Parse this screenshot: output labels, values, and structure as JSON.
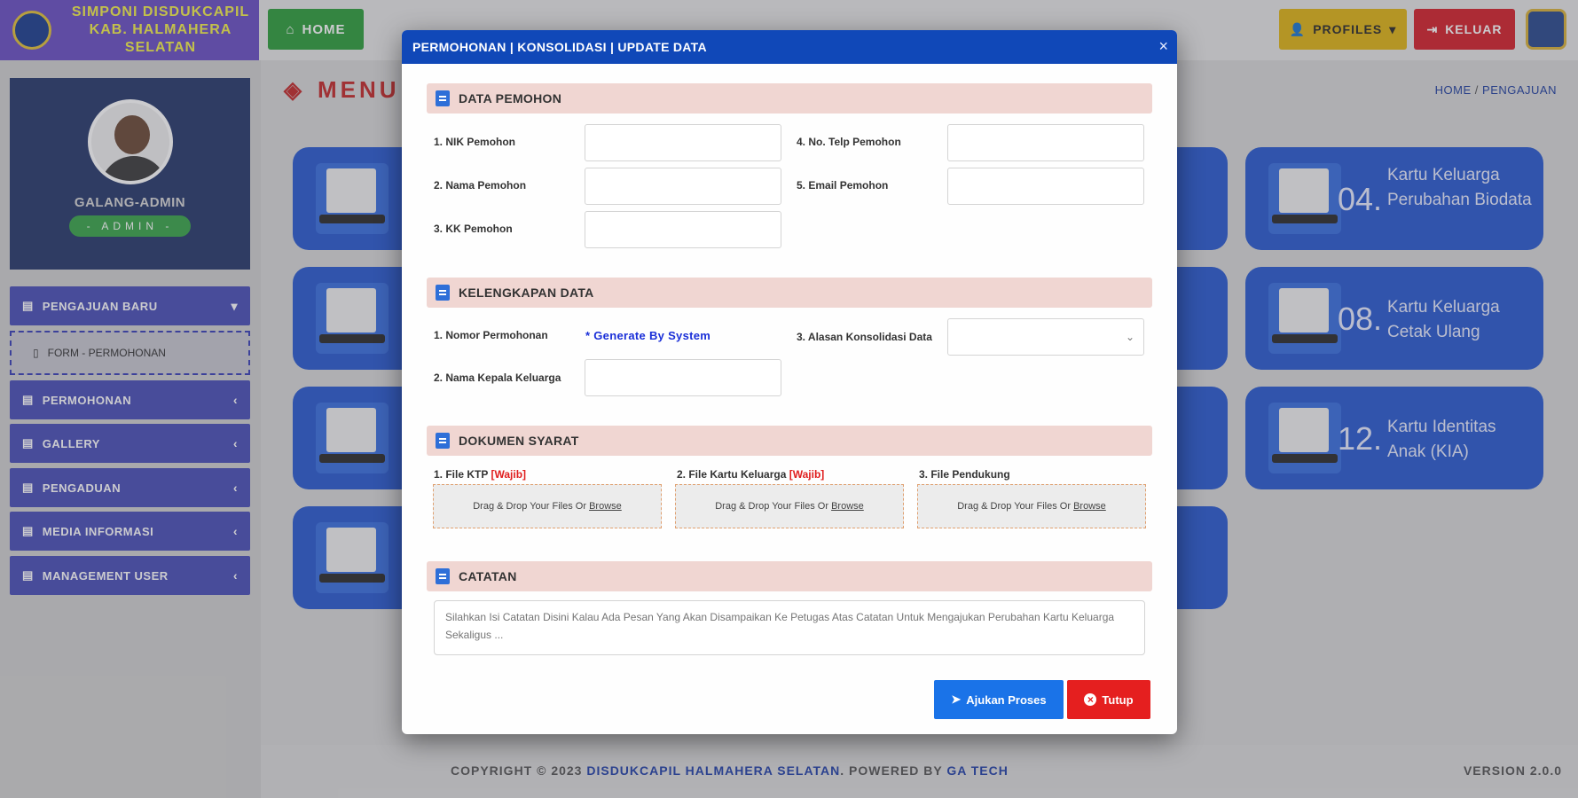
{
  "brand": {
    "line1": "SIMPONI DISDUKCAPIL",
    "line2": "KAB. HALMAHERA SELATAN"
  },
  "topbar": {
    "home": "HOME",
    "profile": "PROFILES",
    "logout": "KELUAR"
  },
  "user": {
    "name": "GALANG-ADMIN",
    "role": "ADMIN"
  },
  "sidebar": {
    "items": [
      {
        "label": "PENGAJUAN BARU",
        "chevron": "▾"
      },
      {
        "label": "FORM - PERMOHONAN"
      },
      {
        "label": "PERMOHONAN",
        "chevron": "‹"
      },
      {
        "label": "GALLERY",
        "chevron": "‹"
      },
      {
        "label": "PENGADUAN",
        "chevron": "‹"
      },
      {
        "label": "MEDIA INFORMASI",
        "chevron": "‹"
      },
      {
        "label": "MANAGEMENT USER",
        "chevron": "‹"
      }
    ]
  },
  "content": {
    "title": "MENU P",
    "breadcrumb": {
      "home": "HOME",
      "sep": "/",
      "current": "PENGAJUAN"
    }
  },
  "cards": [
    {
      "num": "04.",
      "text": "Kartu Keluarga Perubahan Biodata"
    },
    {
      "num": "08.",
      "text": "Kartu Keluarga Cetak Ulang"
    },
    {
      "num": "12.",
      "text": "Kartu Identitas Anak (KIA)"
    }
  ],
  "modal": {
    "title": "PERMOHONAN | KONSOLIDASI | UPDATE DATA",
    "close": "×",
    "sections": {
      "pemohon": "DATA PEMOHON",
      "kelengkapan": "KELENGKAPAN DATA",
      "dokumen": "DOKUMEN SYARAT",
      "catatan": "CATATAN"
    },
    "pemohon": {
      "nik": "1. NIK Pemohon",
      "nama": "2. Nama Pemohon",
      "kk": "3. KK Pemohon",
      "telp": "4. No. Telp Pemohon",
      "email": "5. Email Pemohon"
    },
    "kelengkapan": {
      "nomor": "1. Nomor Permohonan",
      "generate": "* Generate By System",
      "kepala": "2. Nama Kepala Keluarga",
      "alasan": "3. Alasan Konsolidasi Data"
    },
    "dokumen": {
      "ktp": "1. File KTP",
      "kk": "2. File Kartu Keluarga",
      "pendukung": "3. File Pendukung",
      "wajib": "[Wajib]",
      "drop_prefix": "Drag & Drop Your Files Or ",
      "drop_link": "Browse"
    },
    "catatan_placeholder": "Silahkan Isi Catatan Disini Kalau Ada Pesan Yang Akan Disampaikan Ke Petugas Atas Catatan Untuk Mengajukan Perubahan Kartu Keluarga Sekaligus ...",
    "submit": "Ajukan Proses",
    "tutup": "Tutup"
  },
  "footer": {
    "copyright": "COPYRIGHT © 2023 ",
    "org": "DISDUKCAPIL HALMAHERA SELATAN",
    "powered": ". POWERED BY ",
    "vendor": "GA TECH",
    "version": "VERSION 2.0.0"
  },
  "colors": {
    "modal_header": "#1048b8",
    "section_bg": "#f0d6d2",
    "submit": "#1a73e8",
    "tutup": "#e51f1f",
    "sidebar_nav": "#4a4fb8"
  }
}
